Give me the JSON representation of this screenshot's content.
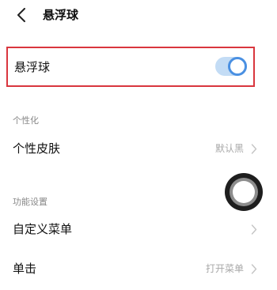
{
  "header": {
    "title": "悬浮球",
    "back_icon": "chevron-left-icon"
  },
  "float_toggle": {
    "label": "悬浮球",
    "enabled": true,
    "accent_color": "#4a90e2",
    "highlight_color": "#d9363e"
  },
  "sections": [
    {
      "title": "个性化",
      "rows": [
        {
          "label": "个性皮肤",
          "value": "默认黑"
        }
      ]
    },
    {
      "title": "功能设置",
      "rows": [
        {
          "label": "自定义菜单",
          "value": ""
        },
        {
          "label": "单击",
          "value": "打开菜单"
        }
      ]
    }
  ]
}
